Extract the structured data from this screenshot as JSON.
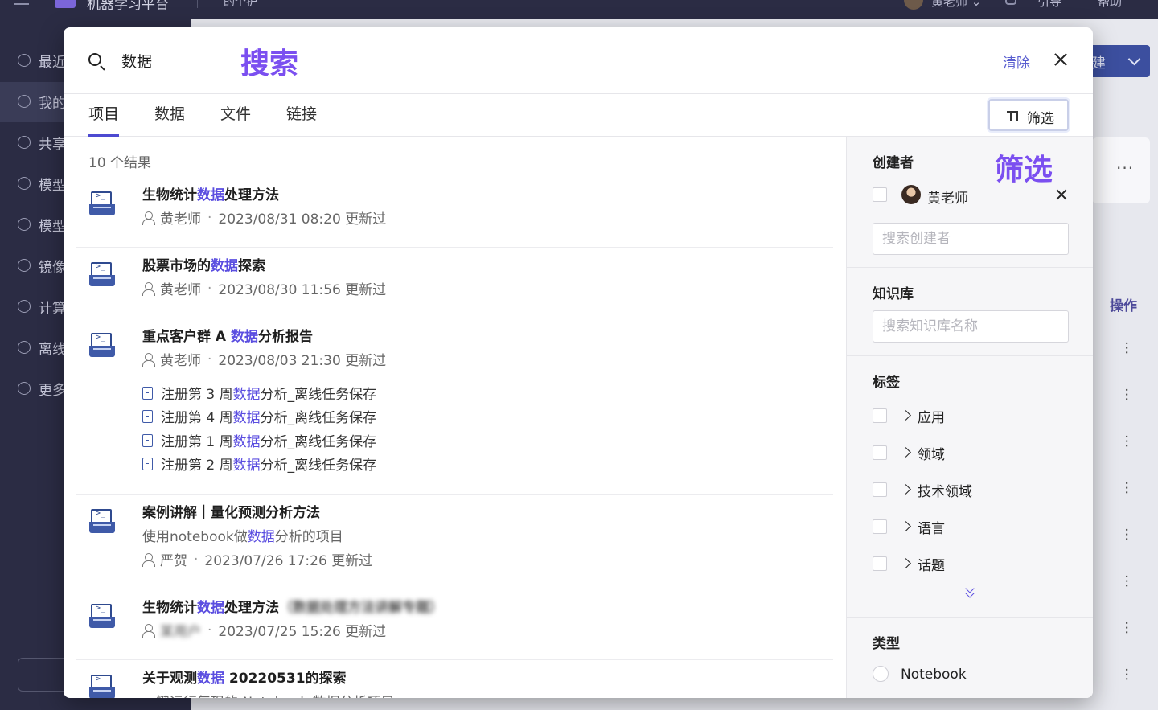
{
  "background": {
    "app_name": "机器学习平台",
    "workspace": "的个护",
    "user_name": "黄老师 ⌄",
    "guide": "引导",
    "help": "帮助",
    "sidebar": [
      {
        "label": "最近",
        "icon": "clock-icon"
      },
      {
        "label": "我的",
        "icon": "user-edit-icon"
      },
      {
        "label": "共享",
        "icon": "share-icon"
      },
      {
        "label": "模型",
        "icon": "cube-icon"
      },
      {
        "label": "模型",
        "icon": "flask-icon"
      },
      {
        "label": "镜像",
        "icon": "container-icon"
      },
      {
        "label": "计算",
        "icon": "compute-icon"
      },
      {
        "label": "离线",
        "icon": "chip-icon"
      },
      {
        "label": "更多",
        "icon": "more-icon"
      }
    ],
    "new_button": "建",
    "card_more": "···",
    "operations_header": "操作",
    "row_more": "···"
  },
  "search": {
    "value": "数据",
    "annotation": "搜索",
    "clear": "清除"
  },
  "tabs": [
    {
      "label": "项目",
      "active": true
    },
    {
      "label": "数据",
      "active": false
    },
    {
      "label": "文件",
      "active": false
    },
    {
      "label": "链接",
      "active": false
    }
  ],
  "filter_button": "筛选",
  "results": {
    "count": "10 个结果",
    "items": [
      {
        "title_pre": "生物统计",
        "title_hl": "数据",
        "title_post": "处理方法",
        "author": "黄老师",
        "sep": "·",
        "updated": "2023/08/31 08:20 更新过"
      },
      {
        "title_pre": "股票市场的",
        "title_hl": "数据",
        "title_post": "探索",
        "author": "黄老师",
        "sep": "·",
        "updated": "2023/08/30 11:56 更新过"
      },
      {
        "title_pre": "重点客户群 A ",
        "title_hl": "数据",
        "title_post": "分析报告",
        "author": "黄老师",
        "sep": "·",
        "updated": "2023/08/03 21:30 更新过",
        "sub_items": [
          {
            "pre": "注册第 3 周",
            "hl": "数据",
            "post": "分析_离线任务保存"
          },
          {
            "pre": "注册第 4 周",
            "hl": "数据",
            "post": "分析_离线任务保存"
          },
          {
            "pre": "注册第 1 周",
            "hl": "数据",
            "post": "分析_离线任务保存"
          },
          {
            "pre": "注册第 2 周",
            "hl": "数据",
            "post": "分析_离线任务保存"
          }
        ]
      },
      {
        "title": "案例讲解｜量化预测分析方法",
        "desc_pre": "使用notebook做",
        "desc_hl": "数据",
        "desc_post": "分析的项目",
        "author": "严贺",
        "sep": "·",
        "updated": "2023/07/26 17:26 更新过"
      },
      {
        "title_pre": "生物统计",
        "title_hl": "数据",
        "title_post": "处理方法",
        "title_blur": "（数据处理方法讲解专题）",
        "author": "某用户",
        "sep": "·",
        "updated": "2023/07/25 15:26 更新过"
      },
      {
        "title_pre": "关于观测",
        "title_hl": "数据",
        "title_post": " 20220531的探索",
        "desc": "一键运行复现的 Notebook 数据分析项目"
      }
    ]
  },
  "panel": {
    "annotation": "筛选",
    "creator": {
      "title": "创建者",
      "selected_name": "黄老师",
      "placeholder": "搜索创建者"
    },
    "knowledge": {
      "title": "知识库",
      "placeholder": "搜索知识库名称"
    },
    "tags": {
      "title": "标签",
      "items": [
        "应用",
        "领域",
        "技术领域",
        "语言",
        "话题"
      ]
    },
    "type": {
      "title": "类型",
      "option": "Notebook"
    }
  }
}
